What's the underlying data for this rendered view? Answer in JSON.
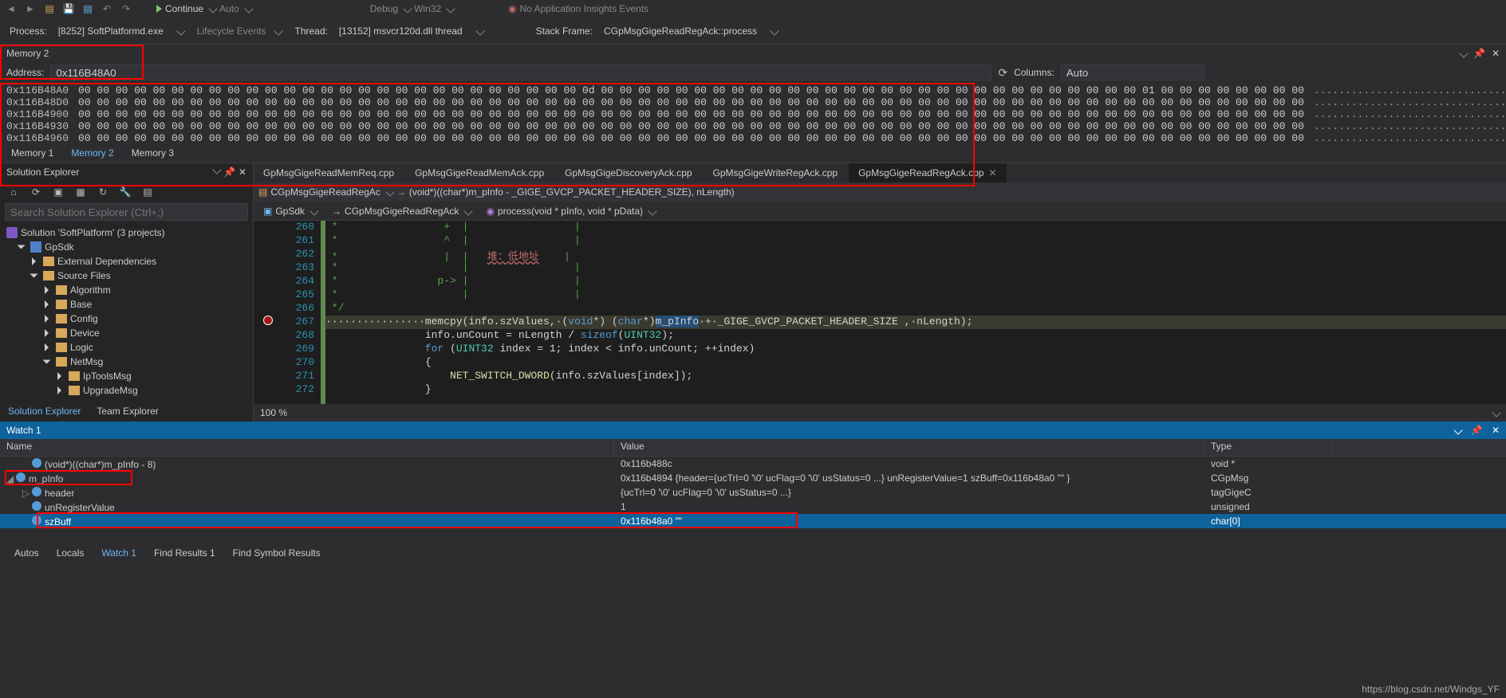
{
  "top_icons": [
    "nav",
    "nav",
    "open",
    "save",
    "save-all",
    "undo",
    "redo"
  ],
  "top_buttons": {
    "continue": "Continue",
    "auto1": "Auto",
    "debug": "Debug",
    "win32": "Win32",
    "insights": "No Application Insights Events"
  },
  "debug_row": {
    "process_label": "Process:",
    "process_value": "[8252] SoftPlatformd.exe",
    "lifecycle": "Lifecycle Events",
    "thread_label": "Thread:",
    "thread_value": "[13152] msvcr120d.dll thread",
    "stack_label": "Stack Frame:",
    "stack_value": "CGpMsgGigeReadRegAck::process"
  },
  "memory": {
    "title": "Memory 2",
    "address_label": "Address:",
    "address_value": "0x116B48A0",
    "columns_label": "Columns:",
    "columns_value": "Auto",
    "rows": [
      {
        "addr": "0x116B48A0",
        "bytes": "00 00 00 00 00 00 00 00 00 00 00 00 00 00 00 00 00 00 00 00 00 00 00 00 00 00 00 0d 00 00 00 00 00 00 00 00 00 00 00 00 00 00 00 00 00 00 00 00 00 00 00 00 00 00 00 00 00 01 00 00 00 00 00 00 00 00",
        "ascii": ".................................................................."
      },
      {
        "addr": "0x116B48D0",
        "bytes": "00 00 00 00 00 00 00 00 00 00 00 00 00 00 00 00 00 00 00 00 00 00 00 00 00 00 00 00 00 00 00 00 00 00 00 00 00 00 00 00 00 00 00 00 00 00 00 00 00 00 00 00 00 00 00 00 00 00 00 00 00 00 00 00 00 00",
        "ascii": ".................................................................."
      },
      {
        "addr": "0x116B4900",
        "bytes": "00 00 00 00 00 00 00 00 00 00 00 00 00 00 00 00 00 00 00 00 00 00 00 00 00 00 00 00 00 00 00 00 00 00 00 00 00 00 00 00 00 00 00 00 00 00 00 00 00 00 00 00 00 00 00 00 00 00 00 00 00 00 00 00 00 00",
        "ascii": ".................................................................."
      },
      {
        "addr": "0x116B4930",
        "bytes": "00 00 00 00 00 00 00 00 00 00 00 00 00 00 00 00 00 00 00 00 00 00 00 00 00 00 00 00 00 00 00 00 00 00 00 00 00 00 00 00 00 00 00 00 00 00 00 00 00 00 00 00 00 00 00 00 00 00 00 00 00 00 00 00 00 00",
        "ascii": ".................................................................."
      },
      {
        "addr": "0x116B4960",
        "bytes": "00 00 00 00 00 00 00 00 00 00 00 00 00 00 00 00 00 00 00 00 00 00 00 00 00 00 00 00 00 00 00 00 00 00 00 00 00 00 00 00 00 00 00 00 00 00 00 00 00 00 00 00 00 00 00 00 00 00 00 00 00 00 00 00 00 00",
        "ascii": ".................................................................."
      }
    ],
    "tabs": [
      "Memory 1",
      "Memory 2",
      "Memory 3"
    ]
  },
  "solution": {
    "title": "Solution Explorer",
    "search_placeholder": "Search Solution Explorer (Ctrl+;)",
    "root": "Solution 'SoftPlatform' (3 projects)",
    "nodes": [
      {
        "label": "GpSdk",
        "icon": "proj",
        "expanded": true,
        "depth": 1
      },
      {
        "label": "External Dependencies",
        "icon": "folder",
        "expanded": false,
        "depth": 2
      },
      {
        "label": "Source Files",
        "icon": "folder",
        "expanded": true,
        "depth": 2
      },
      {
        "label": "Algorithm",
        "icon": "folder",
        "expanded": false,
        "depth": 3
      },
      {
        "label": "Base",
        "icon": "folder",
        "expanded": false,
        "depth": 3
      },
      {
        "label": "Config",
        "icon": "folder",
        "expanded": false,
        "depth": 3
      },
      {
        "label": "Device",
        "icon": "folder",
        "expanded": false,
        "depth": 3
      },
      {
        "label": "Logic",
        "icon": "folder",
        "expanded": false,
        "depth": 3
      },
      {
        "label": "NetMsg",
        "icon": "folder",
        "expanded": true,
        "depth": 3
      },
      {
        "label": "IpToolsMsg",
        "icon": "folder",
        "expanded": false,
        "depth": 4
      },
      {
        "label": "UpgradeMsg",
        "icon": "folder",
        "expanded": false,
        "depth": 4
      }
    ],
    "tabs": [
      "Solution Explorer",
      "Team Explorer"
    ]
  },
  "code": {
    "tabs": [
      "GpMsgGigeReadMemReq.cpp",
      "GpMsgGigeReadMemAck.cpp",
      "GpMsgGigeDiscoveryAck.cpp",
      "GpMsgGigeWriteRegAck.cpp",
      "GpMsgGigeReadRegAck.cpp"
    ],
    "active_tab": 4,
    "context_file": "CGpMsgGigeReadRegAc",
    "context_call": "(void*)((char*)m_pInfo - _GIGE_GVCP_PACKET_HEADER_SIZE), nLength)",
    "nav_project": "GpSdk",
    "nav_class": "CGpMsgGigeReadRegAck",
    "nav_method": "process(void * pInfo, void * pData)",
    "lines": [
      {
        "n": 260,
        "c": " *                 +  |                 |"
      },
      {
        "n": 261,
        "c": " *                 ^  |                 |"
      },
      {
        "n": 262,
        "c": " *                 |  |   堆：低地址    |"
      },
      {
        "n": 263,
        "c": " *                    |                 |"
      },
      {
        "n": 264,
        "c": " *                p-> |                 |"
      },
      {
        "n": 265,
        "c": " *                    |                 |"
      },
      {
        "n": 266,
        "c": " */"
      },
      {
        "n": 267,
        "c": "                memcpy(info.szValues, (void*) (char*)m_pInfo + _GIGE_GVCP_PACKET_HEADER_SIZE , nLength);"
      },
      {
        "n": 268,
        "c": "                info.unCount = nLength / sizeof(UINT32);"
      },
      {
        "n": 269,
        "c": "                for (UINT32 index = 1; index < info.unCount; ++index)"
      },
      {
        "n": 270,
        "c": "                {"
      },
      {
        "n": 271,
        "c": "                    NET_SWITCH_DWORD(info.szValues[index]);"
      },
      {
        "n": 272,
        "c": "                }"
      }
    ],
    "bp_line": 267,
    "zoom": "100 %"
  },
  "watch": {
    "title": "Watch 1",
    "cols": [
      "Name",
      "Value",
      "Type"
    ],
    "rows": [
      {
        "name": "(void*)((char*)m_pInfo - 8)",
        "value": "0x116b488c",
        "type": "void *",
        "depth": 1,
        "exp": "none"
      },
      {
        "name": "m_pInfo",
        "value": "0x116b4894 {header={ucTrl=0 '\\0' ucFlag=0 '\\0' usStatus=0 ...} unRegisterValue=1 szBuff=0x116b48a0 \"\" }",
        "type": "CGpMsg",
        "depth": 0,
        "exp": "expanded"
      },
      {
        "name": "header",
        "value": "{ucTrl=0 '\\0' ucFlag=0 '\\0' usStatus=0 ...}",
        "type": "tagGigeC",
        "depth": 1,
        "exp": "collapsed"
      },
      {
        "name": "unRegisterValue",
        "value": "1",
        "type": "unsigned",
        "depth": 1,
        "exp": "none"
      },
      {
        "name": "szBuff",
        "value": "0x116b48a0 \"\"",
        "type": "char[0]",
        "depth": 1,
        "exp": "none",
        "selected": true
      }
    ]
  },
  "bottom_tabs": [
    "Autos",
    "Locals",
    "Watch 1",
    "Find Results 1",
    "Find Symbol Results"
  ],
  "bottom_active": 2,
  "footer_url": "https://blog.csdn.net/Windgs_YF"
}
